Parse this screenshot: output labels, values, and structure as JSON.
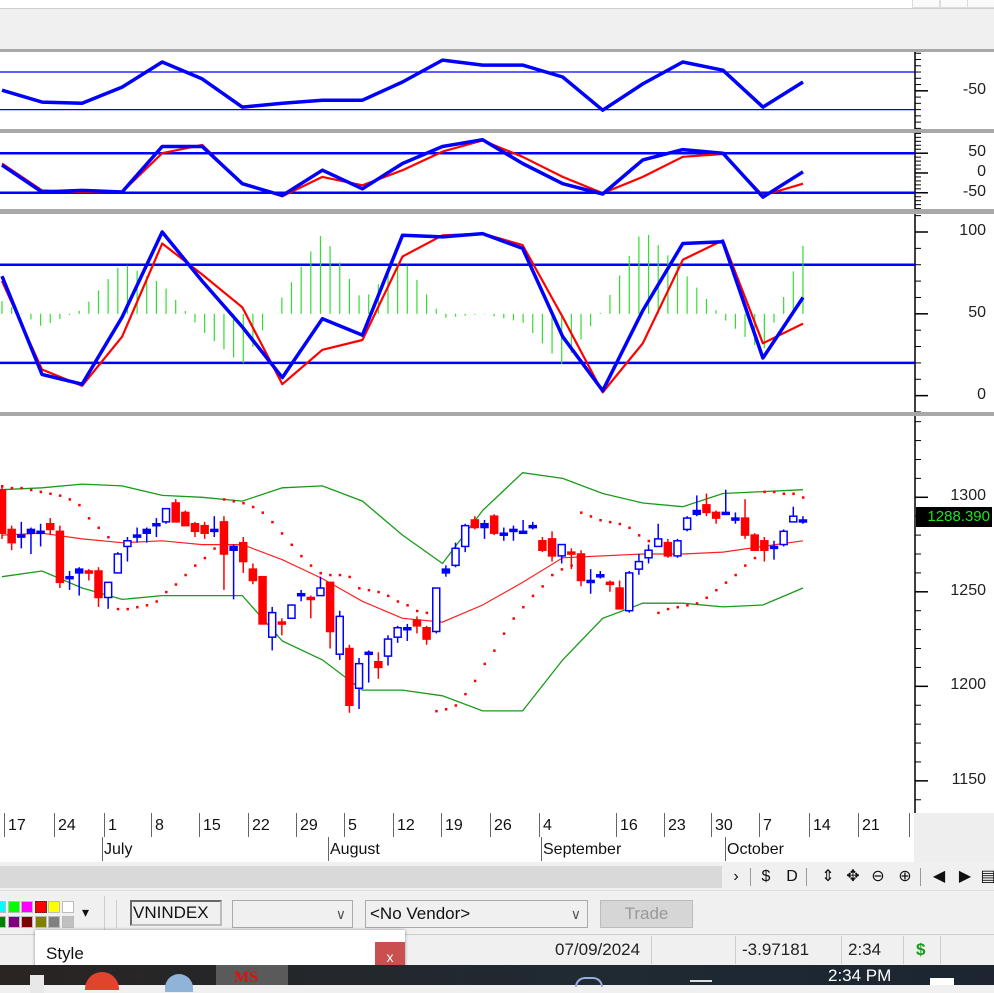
{
  "app": {
    "window_buttons": [
      "minimize",
      "maximize",
      "close"
    ]
  },
  "colors": {
    "up_candle": "#0000ff",
    "down_candle": "#ff0000",
    "bollinger_band": "#1a9a1a",
    "bollinger_mid": "#ff2020",
    "sar": "#ff0000",
    "indicator_fast": "#0000ff",
    "indicator_slow": "#ff0000",
    "histogram": "#33dd33",
    "reference_line": "#0000ff",
    "price_tag_bg": "#000000",
    "price_tag_text": "#1ee31e"
  },
  "chart_data": [
    {
      "type": "line",
      "pane": "oscillator-1",
      "ylim": [
        -111,
        12
      ],
      "tick_labels": [
        "-50"
      ],
      "ticks": [
        -50
      ],
      "reference_lines": [
        -20,
        -80
      ],
      "series": [
        {
          "values": [
            -49,
            -68,
            -70,
            -44,
            -4,
            -31,
            -76,
            -70,
            -65,
            -65,
            -36,
            -1,
            -9,
            -9,
            -28,
            -81,
            -39,
            -4,
            -17,
            -76,
            -36
          ]
        }
      ]
    },
    {
      "type": "line",
      "pane": "oscillator-2",
      "ylim": [
        -91,
        101
      ],
      "tick_labels": [
        "50",
        "0",
        "-50"
      ],
      "ticks": [
        50,
        0,
        -50
      ],
      "reference_lines": [
        50,
        -50
      ],
      "series": [
        {
          "values": [
            20,
            -48,
            -44,
            -48,
            67,
            67,
            -27,
            -57,
            7,
            -40,
            24,
            67,
            84,
            24,
            -27,
            -53,
            33,
            59,
            50,
            -61,
            3
          ]
        },
        {
          "values": [
            24,
            -44,
            -48,
            -48,
            50,
            71,
            -27,
            -59,
            -10,
            -31,
            7,
            54,
            82,
            41,
            -10,
            -51,
            -10,
            41,
            48,
            -57,
            -27
          ]
        }
      ]
    },
    {
      "type": "line",
      "pane": "stochastic",
      "ylim": [
        -10,
        111
      ],
      "tick_labels": [
        "100",
        "50",
        "0"
      ],
      "ticks": [
        100,
        50,
        0
      ],
      "reference_lines": [
        80,
        20
      ],
      "histogram_baseline": 50,
      "series": [
        {
          "values": [
            73,
            13,
            7,
            48,
            100,
            70,
            42,
            11,
            47,
            37,
            98,
            97,
            99,
            90,
            36,
            3,
            52,
            93,
            94,
            23,
            60
          ]
        },
        {
          "values": [
            70,
            16,
            6,
            36,
            93,
            74,
            54,
            7,
            28,
            34,
            85,
            98,
            99,
            92,
            48,
            2,
            32,
            83,
            95,
            32,
            44
          ]
        }
      ]
    },
    {
      "type": "candlestick",
      "pane": "price",
      "symbol": "VNINDEX",
      "ylim": [
        1133,
        1343
      ],
      "tick_labels": [
        "1300",
        "1250",
        "1200",
        "1150"
      ],
      "ticks": [
        1300,
        1250,
        1200,
        1150
      ],
      "last_price": "1288.390",
      "x_tick_labels": [
        "17",
        "24",
        "1",
        "8",
        "15",
        "22",
        "29",
        "5",
        "12",
        "19",
        "26",
        "4",
        "16",
        "23",
        "30",
        "7",
        "14",
        "21"
      ],
      "x_month_labels": [
        "July",
        "August",
        "September",
        "October"
      ],
      "ohlc": [
        [
          1304,
          1306,
          1278,
          1281
        ],
        [
          1283,
          1285,
          1272,
          1276
        ],
        [
          1280,
          1287,
          1273,
          1280
        ],
        [
          1281,
          1284,
          1270,
          1283
        ],
        [
          1281,
          1286,
          1274,
          1282
        ],
        [
          1286,
          1289,
          1280,
          1283
        ],
        [
          1282,
          1285,
          1252,
          1255
        ],
        [
          1257,
          1261,
          1251,
          1258
        ],
        [
          1260,
          1263,
          1248,
          1262
        ],
        [
          1261,
          1262,
          1256,
          1260
        ],
        [
          1261,
          1263,
          1242,
          1247
        ],
        [
          1247,
          1255,
          1241,
          1255
        ],
        [
          1260,
          1271,
          1260,
          1270
        ],
        [
          1274,
          1279,
          1266,
          1277
        ],
        [
          1279,
          1284,
          1276,
          1280
        ],
        [
          1281,
          1284,
          1276,
          1283
        ],
        [
          1285,
          1289,
          1279,
          1286
        ],
        [
          1287,
          1294,
          1286,
          1294
        ],
        [
          1297,
          1299,
          1287,
          1287
        ],
        [
          1292,
          1293,
          1285,
          1285
        ],
        [
          1286,
          1287,
          1279,
          1282
        ],
        [
          1285,
          1287,
          1278,
          1281
        ],
        [
          1282,
          1290,
          1279,
          1283
        ],
        [
          1287,
          1290,
          1251,
          1270
        ],
        [
          1272,
          1275,
          1246,
          1274
        ],
        [
          1276,
          1279,
          1260,
          1266
        ],
        [
          1262,
          1265,
          1254,
          1256
        ],
        [
          1258,
          1258,
          1233,
          1233
        ],
        [
          1226,
          1242,
          1219,
          1239
        ],
        [
          1234,
          1236,
          1227,
          1233
        ],
        [
          1236,
          1243,
          1236,
          1243
        ],
        [
          1248,
          1251,
          1245,
          1249
        ],
        [
          1247,
          1248,
          1236,
          1246
        ],
        [
          1248,
          1258,
          1248,
          1252
        ],
        [
          1255,
          1255,
          1220,
          1229
        ],
        [
          1217,
          1240,
          1214,
          1237
        ],
        [
          1220,
          1222,
          1186,
          1190
        ],
        [
          1199,
          1215,
          1188,
          1212
        ],
        [
          1217,
          1219,
          1202,
          1218
        ],
        [
          1213,
          1218,
          1204,
          1210
        ],
        [
          1216,
          1227,
          1211,
          1225
        ],
        [
          1226,
          1232,
          1223,
          1231
        ],
        [
          1230,
          1233,
          1224,
          1231
        ],
        [
          1235,
          1237,
          1228,
          1232
        ],
        [
          1231,
          1232,
          1222,
          1225
        ],
        [
          1229,
          1252,
          1228,
          1252
        ],
        [
          1260,
          1264,
          1258,
          1262
        ],
        [
          1264,
          1276,
          1263,
          1273
        ],
        [
          1274,
          1286,
          1271,
          1285
        ],
        [
          1288,
          1290,
          1283,
          1284
        ],
        [
          1284,
          1288,
          1278,
          1286
        ],
        [
          1290,
          1291,
          1280,
          1281
        ],
        [
          1281,
          1284,
          1277,
          1281
        ],
        [
          1282,
          1285,
          1277,
          1283
        ],
        [
          1282,
          1288,
          1281,
          1282
        ],
        [
          1284,
          1287,
          1283,
          1285
        ],
        [
          1277,
          1279,
          1271,
          1272
        ],
        [
          1278,
          1282,
          1266,
          1269
        ],
        [
          1269,
          1275,
          1265,
          1275
        ],
        [
          1271,
          1273,
          1262,
          1270
        ],
        [
          1270,
          1272,
          1253,
          1256
        ],
        [
          1256,
          1262,
          1249,
          1256
        ],
        [
          1258,
          1261,
          1257,
          1259
        ],
        [
          1255,
          1256,
          1250,
          1254
        ],
        [
          1252,
          1256,
          1241,
          1241
        ],
        [
          1240,
          1261,
          1239,
          1260
        ],
        [
          1262,
          1270,
          1259,
          1266
        ],
        [
          1268,
          1275,
          1265,
          1272
        ],
        [
          1274,
          1286,
          1274,
          1278
        ],
        [
          1276,
          1278,
          1268,
          1269
        ],
        [
          1269,
          1278,
          1268,
          1277
        ],
        [
          1283,
          1290,
          1282,
          1289
        ],
        [
          1291,
          1301,
          1290,
          1293
        ],
        [
          1296,
          1302,
          1290,
          1292
        ],
        [
          1292,
          1293,
          1286,
          1289
        ],
        [
          1292,
          1304,
          1291,
          1292
        ],
        [
          1289,
          1292,
          1286,
          1289
        ],
        [
          1289,
          1299,
          1278,
          1280
        ],
        [
          1280,
          1281,
          1272,
          1272
        ],
        [
          1277,
          1279,
          1266,
          1272
        ],
        [
          1273,
          1277,
          1267,
          1274
        ],
        [
          1275,
          1283,
          1274,
          1282
        ],
        [
          1287,
          1295,
          1287,
          1290
        ],
        [
          1288,
          1290,
          1286,
          1288
        ]
      ],
      "parabolic_sar": [
        1306,
        1305,
        1305,
        1304,
        1303,
        1302,
        1301,
        1299,
        1296,
        1289,
        1284,
        1279,
        1241,
        1241,
        1242,
        1243,
        1245,
        1250,
        1254,
        1259,
        1264,
        1268,
        1273,
        1299,
        1298,
        1297,
        1295,
        1292,
        1287,
        1281,
        1275,
        1269,
        1264,
        1260,
        1259,
        1259,
        1258,
        1252,
        1251,
        1250,
        1248,
        1245,
        1243,
        1240,
        1239,
        1187,
        1188,
        1190,
        1196,
        1203,
        1212,
        1219,
        1228,
        1236,
        1242,
        1248,
        1253,
        1259,
        1262,
        1264,
        1292,
        1290,
        1288,
        1287,
        1286,
        1284,
        1280,
        1277,
        1239,
        1241,
        1242,
        1243,
        1244,
        1247,
        1251,
        1255,
        1259,
        1264,
        1268,
        1303,
        1303,
        1302,
        1302,
        1300
      ],
      "bollinger": {
        "upper": [
          1304,
          1305,
          1307,
          1306,
          1301,
          1300,
          1298,
          1305,
          1306,
          1298,
          1280,
          1265,
          1293,
          1313,
          1310,
          1302,
          1297,
          1295,
          1302,
          1303,
          1304
        ],
        "middle": [
          1280,
          1281,
          1278,
          1276,
          1277,
          1275,
          1275,
          1267,
          1257,
          1245,
          1236,
          1234,
          1243,
          1255,
          1268,
          1269,
          1270,
          1270,
          1271,
          1274,
          1277
        ],
        "lower": [
          1258,
          1261,
          1252,
          1246,
          1248,
          1248,
          1248,
          1224,
          1214,
          1198,
          1198,
          1195,
          1187,
          1187,
          1214,
          1236,
          1244,
          1244,
          1242,
          1243,
          1252
        ]
      }
    }
  ],
  "nav_tools": {
    "items": [
      {
        "name": "scroll-right",
        "glyph": "›"
      },
      {
        "name": "currency",
        "glyph": "$"
      },
      {
        "name": "period",
        "glyph": "D"
      },
      {
        "name": "vertical-scale",
        "glyph": "⇕"
      },
      {
        "name": "pan",
        "glyph": "✥"
      },
      {
        "name": "zoom-out",
        "glyph": "⊖"
      },
      {
        "name": "zoom-in",
        "glyph": "⊕"
      },
      {
        "name": "previous",
        "glyph": "◀"
      },
      {
        "name": "next",
        "glyph": "▶"
      },
      {
        "name": "list",
        "glyph": "▤"
      }
    ]
  },
  "toolbar": {
    "palette": [
      "#00ffff",
      "#00ff00",
      "#ff00ff",
      "#ff0000",
      "#ffff00",
      "#ffffff",
      "#008000",
      "#800080",
      "#800000",
      "#808000",
      "#808080",
      "#c0c0c0"
    ],
    "palette_selected": "#ff0000",
    "palette_dropdown": "▾",
    "symbol_value": "VNINDEX",
    "combo1_value": "",
    "combo_chevron": "∨",
    "vendor_value": "<No Vendor>",
    "trade_label": "Trade"
  },
  "status": {
    "date": "07/09/2024",
    "value": "-3.97181",
    "time": "2:34",
    "currency_symbol": "$"
  },
  "style_popup": {
    "title": "Style",
    "close_label": "x"
  },
  "taskbar": {
    "clock": "2:34 PM",
    "app_label": "MS"
  }
}
